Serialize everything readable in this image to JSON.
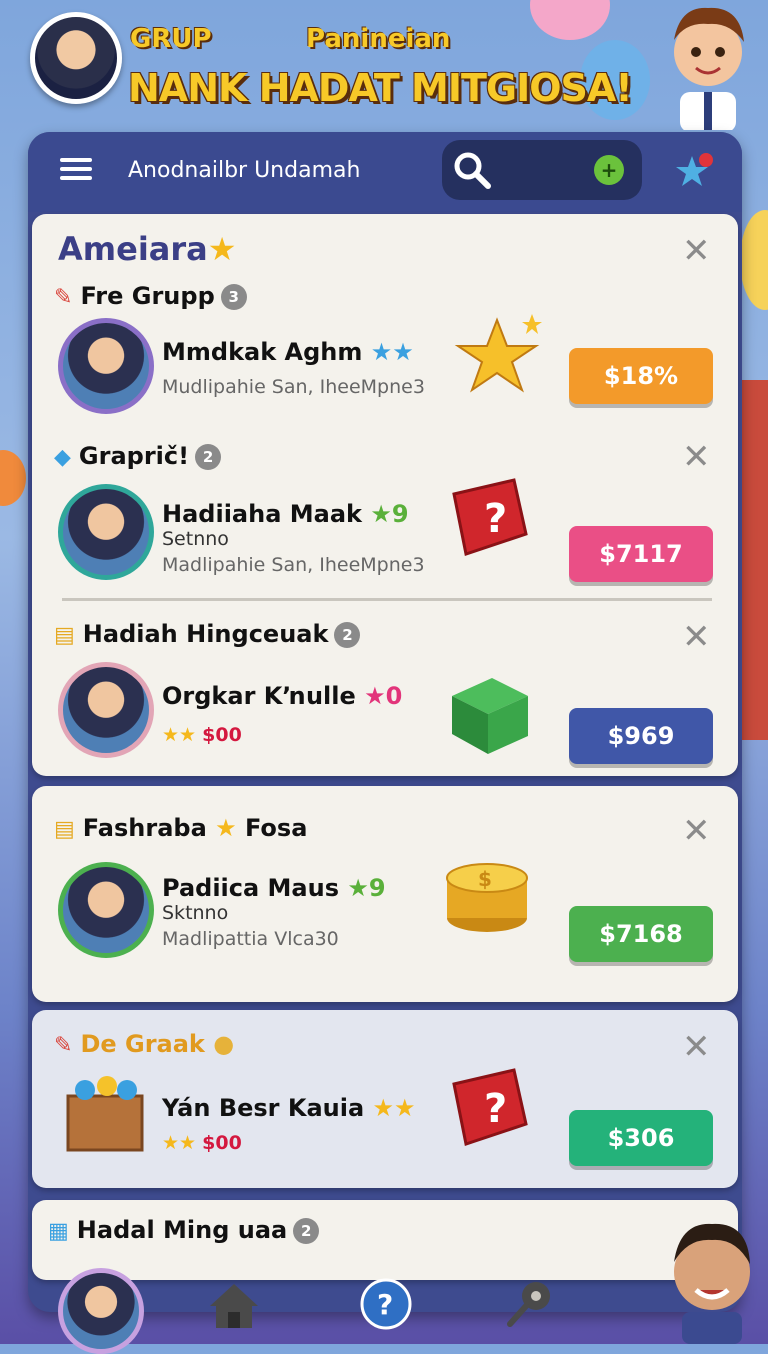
{
  "header": {
    "title_left": "GRUP",
    "title_right": "Panineian",
    "title_main": "NANK HADAT MITGIOSA!"
  },
  "topbar": {
    "title": "Anodnailbr Undamah",
    "add_symbol": "+"
  },
  "card": {
    "title": "Ameiara",
    "close": "✕",
    "sections": [
      {
        "label": "Fre Grupp",
        "count": "3",
        "name": "Mmdkak Aghm",
        "name_suffix": "★★",
        "sub": "",
        "sub2": "Mudlipahie San, IheeMpne3",
        "price": "$18%",
        "price_color": "#f39a2a"
      },
      {
        "label": "Graprič!",
        "count": "2",
        "name": "Hadiiaha Maak",
        "name_suffix": "★9",
        "sub": "Setnno",
        "sub2": "Madlipahie San, IheeMpne3",
        "price": "$7117",
        "price_color": "#ea4f86"
      },
      {
        "label": "Hadiah Hingceuak",
        "count": "2",
        "name": "Orgkar Kŉulle",
        "name_suffix": "★0",
        "sub": "$00",
        "sub2": "",
        "price": "$969",
        "price_color": "#4057a8"
      }
    ]
  },
  "card2": {
    "label": "Fashraba",
    "label_suffix": "Fosa",
    "name": "Padiica Maus",
    "name_suffix": "★9",
    "sub": "Sktnno",
    "sub2": "Madlipattia Vlca30",
    "price": "$7168",
    "price_color": "#4cb04f"
  },
  "card3": {
    "label": "De Graak",
    "name": "Yán Besr Kauia",
    "name_suffix": "★★",
    "sub": "$00",
    "price": "$306",
    "price_color": "#24b27a"
  },
  "card4": {
    "label": "Hadal Ming uaa",
    "count": "2"
  },
  "icons": [
    "menu-icon",
    "search-icon",
    "add-icon",
    "star-icon",
    "close-icon",
    "home-icon",
    "help-icon",
    "key-icon"
  ]
}
